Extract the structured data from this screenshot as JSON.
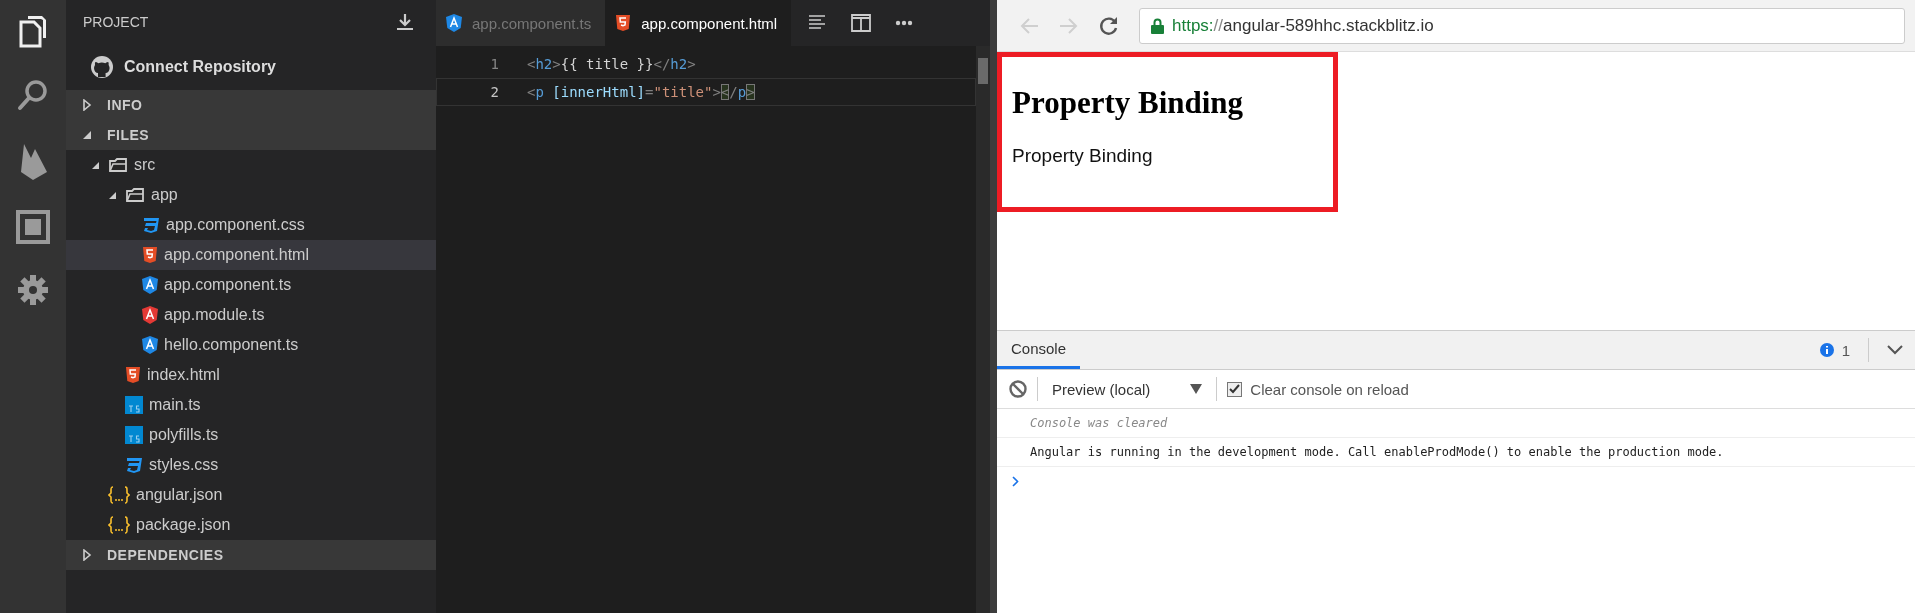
{
  "activity_bar": {
    "items": [
      {
        "kind": "files",
        "selected": true
      },
      {
        "kind": "search",
        "selected": false
      },
      {
        "kind": "flame",
        "selected": false
      },
      {
        "kind": "frame",
        "selected": false
      },
      {
        "kind": "settings",
        "selected": false
      }
    ]
  },
  "sidebar": {
    "title": "PROJECT",
    "connect": "Connect Repository",
    "sections": [
      {
        "label": "INFO",
        "expanded": false
      },
      {
        "label": "FILES",
        "expanded": true,
        "items": [
          {
            "name": "src",
            "kind": "folder",
            "expanded": true,
            "selected": false,
            "children": [
              {
                "name": "app",
                "kind": "folder",
                "expanded": true,
                "selected": false,
                "children": [
                  {
                    "name": "app.component.css",
                    "kind": "css",
                    "selected": false
                  },
                  {
                    "name": "app.component.html",
                    "kind": "html",
                    "selected": true
                  },
                  {
                    "name": "app.component.ts",
                    "kind": "angular",
                    "selected": false
                  },
                  {
                    "name": "app.module.ts",
                    "kind": "angular-module",
                    "selected": false
                  },
                  {
                    "name": "hello.component.ts",
                    "kind": "angular",
                    "selected": false
                  }
                ]
              },
              {
                "name": "index.html",
                "kind": "html",
                "selected": false
              },
              {
                "name": "main.ts",
                "kind": "ts",
                "selected": false
              },
              {
                "name": "polyfills.ts",
                "kind": "ts",
                "selected": false
              },
              {
                "name": "styles.css",
                "kind": "css",
                "selected": false
              }
            ]
          },
          {
            "name": "angular.json",
            "kind": "json",
            "selected": false
          },
          {
            "name": "package.json",
            "kind": "json",
            "selected": false
          }
        ]
      },
      {
        "label": "DEPENDENCIES",
        "expanded": false
      }
    ]
  },
  "editor": {
    "tabs": [
      {
        "label": "app.component.ts",
        "kind": "angular",
        "selected": false
      },
      {
        "label": "app.component.html",
        "kind": "html",
        "selected": true
      }
    ],
    "lines": [
      {
        "number": "1",
        "current": false,
        "tokens": [
          {
            "text": "<",
            "kind": "bracket",
            "matched": false
          },
          {
            "text": "h2",
            "kind": "tag",
            "matched": false
          },
          {
            "text": ">",
            "kind": "bracket",
            "matched": false
          },
          {
            "text": "{{ title }}",
            "kind": "text",
            "matched": false
          },
          {
            "text": "</",
            "kind": "bracket",
            "matched": false
          },
          {
            "text": "h2",
            "kind": "tag",
            "matched": false
          },
          {
            "text": ">",
            "kind": "bracket",
            "matched": false
          }
        ]
      },
      {
        "number": "2",
        "current": true,
        "tokens": [
          {
            "text": "<",
            "kind": "bracket",
            "matched": false
          },
          {
            "text": "p ",
            "kind": "tag",
            "matched": false
          },
          {
            "text": "[innerHtml]",
            "kind": "attr",
            "matched": false
          },
          {
            "text": "=",
            "kind": "bracket",
            "matched": false
          },
          {
            "text": "\"title\"",
            "kind": "string",
            "matched": false
          },
          {
            "text": ">",
            "kind": "bracket",
            "matched": false
          },
          {
            "text": "<",
            "kind": "bracket",
            "matched": true
          },
          {
            "text": "/",
            "kind": "bracket",
            "matched": false
          },
          {
            "text": "p",
            "kind": "tag",
            "matched": false
          },
          {
            "text": ">",
            "kind": "bracket",
            "matched": true
          }
        ]
      }
    ]
  },
  "browser": {
    "nav": [
      {
        "kind": "back",
        "disabled": true
      },
      {
        "kind": "forward",
        "disabled": true
      },
      {
        "kind": "reload",
        "disabled": false
      }
    ],
    "url_scheme": "https:",
    "url_separator": "//",
    "url_host": "angular-589hhc.stackblitz.io",
    "page": {
      "heading": "Property Binding",
      "paragraph": "Property Binding"
    }
  },
  "console": {
    "tabs": [
      {
        "label": "Console",
        "selected": true
      }
    ],
    "info_count": "1",
    "context": "Preview (local)",
    "clear_on_reload": {
      "label": "Clear console on reload",
      "checked": true
    },
    "messages": [
      {
        "text": "Console was cleared",
        "kind": "system"
      },
      {
        "text": "Angular is running in the development mode. Call enableProdMode() to enable the production mode.",
        "kind": "log"
      }
    ]
  }
}
